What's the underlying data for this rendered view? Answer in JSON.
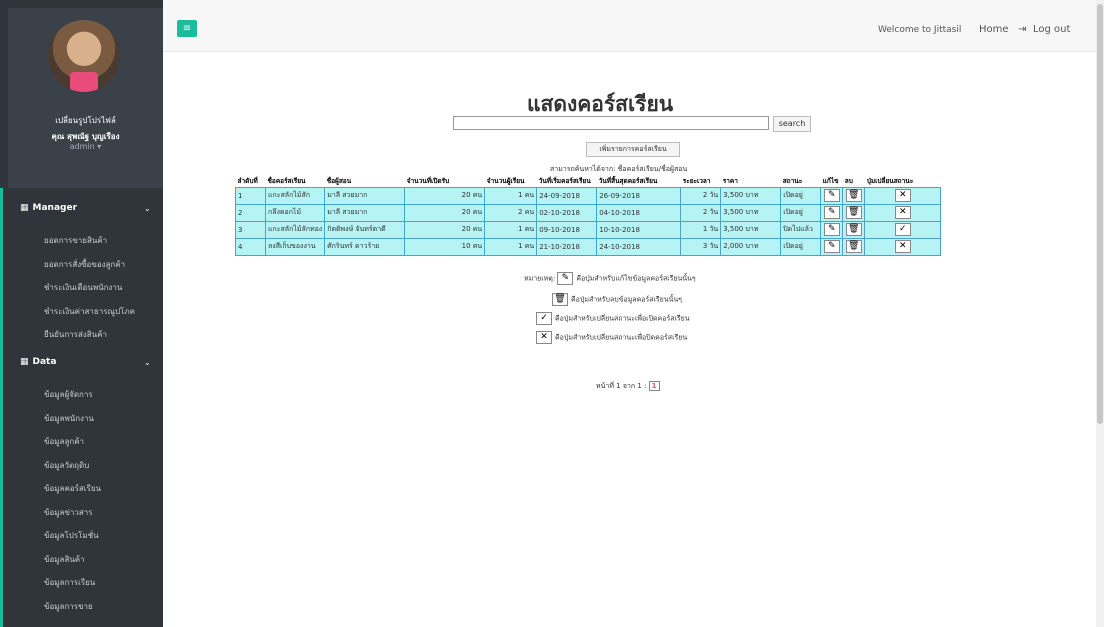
{
  "sidebar": {
    "change_profile": "เปลี่ยนรูปโปรไฟล์",
    "user_name": "คุณ สุพณัฐ บุญเรือง",
    "role": "admin ▾",
    "sections": [
      {
        "icon": "grid-icon",
        "label": "Manager",
        "items": [
          "ยอดการขายสินค้า",
          "ยอดการสั่งซื้อของลูกค้า",
          "ชำระเงินเดือนพนักงาน",
          "ชำระเงินค่าสาธารณูปโภค",
          "ยืนยันการส่งสินค้า"
        ]
      },
      {
        "icon": "grid-icon",
        "label": "Data",
        "items": [
          "ข้อมูลผู้จัดการ",
          "ข้อมูลพนักงาน",
          "ข้อมูลลูกค้า",
          "ข้อมูลวัตถุดิบ",
          "ข้อมูลคอร์สเรียน",
          "ข้อมูลข่าวสาร",
          "ข้อมูลโปรโมชั่น",
          "ข้อมูลสินค้า",
          "ข้อมูลการเรียน",
          "ข้อมูลการขาย"
        ]
      }
    ]
  },
  "topbar": {
    "menu_icon": "≡",
    "welcome": "Welcome to Jittasil",
    "home": "Home",
    "logout": "Log out"
  },
  "page": {
    "title": "แสดงคอร์สเรียน",
    "search_value": "",
    "search_button": "search",
    "add_button": "เพิ่มรายการคอร์สเรียน",
    "hint": "สามารถค้นหาได้จาก: ชื่อคอร์สเรียน/ชื่อผู้สอน"
  },
  "table": {
    "headers": [
      "ลำดับที่",
      "ชื่อคอร์สเรียน",
      "ชื่อผู้สอน",
      "จำนวนที่เปิดรับ",
      "จำนวนผู้เรียน",
      "วันที่เริ่มคอร์สเรียน",
      "วันที่สิ้นสุดคอร์สเรียน",
      "ระยะเวลา",
      "ราคา",
      "สถานะ",
      "แก้ไข",
      "ลบ",
      "ปุ่มเปลี่ยนสถานะ"
    ],
    "rows": [
      {
        "no": "1",
        "course": "แกะสลักไม้สัก",
        "teacher": "มาลี สวยมาก",
        "capacity": "20 คน",
        "learners": "1 คน",
        "start": "24-09-2018",
        "end": "26-09-2018",
        "duration": "2 วัน",
        "price": "3,500 บาท",
        "status": "เปิดอยู่",
        "toggle": "✕"
      },
      {
        "no": "2",
        "course": "กลึงดอกไม้",
        "teacher": "มาลี สวยมาก",
        "capacity": "20 คน",
        "learners": "2 คน",
        "start": "02-10-2018",
        "end": "04-10-2018",
        "duration": "2 วัน",
        "price": "3,500 บาท",
        "status": "เปิดอยู่",
        "toggle": "✕"
      },
      {
        "no": "3",
        "course": "แกะสลักไม้ลักทอง",
        "teacher": "กิตติพงษ์ จันทร์ตาดี",
        "capacity": "20 คน",
        "learners": "1 คน",
        "start": "09-10-2018",
        "end": "10-10-2018",
        "duration": "1 วัน",
        "price": "3,500 บาท",
        "status": "ปิดไปแล้ว",
        "toggle": "✓"
      },
      {
        "no": "4",
        "course": "ลงสีเก็บของงาน",
        "teacher": "ศักรินทร์ ดาวร้าย",
        "capacity": "10 คน",
        "learners": "1 คน",
        "start": "21-10-2018",
        "end": "24-10-2018",
        "duration": "3 วัน",
        "price": "2,000 บาท",
        "status": "เปิดอยู่",
        "toggle": "✕"
      }
    ]
  },
  "legend": {
    "prefix": "หมายเหตุ:",
    "edit": "คือปุ่มสำหรับแก้ไขข้อมูลคอร์สเรียนนั้นๆ",
    "delete": "คือปุ่มสำหรับลบข้อมูลคอร์สเรียนนั้นๆ",
    "open": "คือปุ่มสำหรับเปลี่ยนสถานะเพื่อเปิดคอร์สเรียน",
    "close": "คือปุ่มสำหรับเปลี่ยนสถานะเพื่อปิดคอร์สเรียน"
  },
  "pager": {
    "text": "หน้าที่ 1 จาก 1 :",
    "current": "1"
  },
  "icons": {
    "edit": "pencil-icon",
    "delete": "trash-icon",
    "open": "check-icon",
    "close": "x-icon"
  },
  "colors": {
    "sidebar": "#2f353b",
    "accent": "#1abc9c",
    "row": "#b5f3f5"
  }
}
